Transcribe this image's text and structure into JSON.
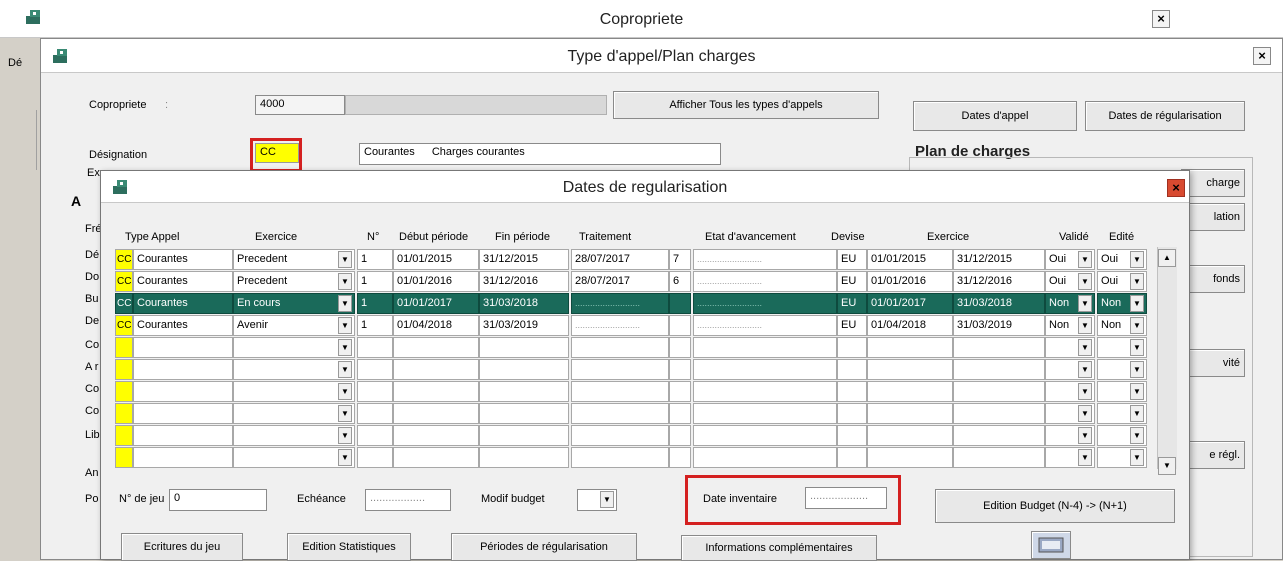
{
  "main_window": {
    "title": "Copropriete",
    "left_label": "Dé"
  },
  "type_window": {
    "title": "Type d'appel/Plan charges",
    "copropriete_label": "Copropriete",
    "copropriete_colon": ":",
    "copropriete_value": "4000",
    "afficher_button": "Afficher Tous les types d'appels",
    "dates_appel_button": "Dates d'appel",
    "dates_regul_button": "Dates de régularisation",
    "designation_label": "Désignation",
    "designation_code": "CC",
    "designation_short": "Courantes",
    "designation_long": "Charges courantes",
    "exercice_label_fragment": "Ex",
    "plan_charges_title": "Plan de charges",
    "side_labels": [
      "A",
      "Fré",
      "Dé",
      "Do",
      "Bu",
      "De",
      "Co",
      "A r",
      "Co",
      "Co",
      "Lib",
      "An",
      "Po"
    ],
    "right_buttons": [
      " charge",
      "lation",
      "fonds",
      "vité",
      "e régl."
    ]
  },
  "dialog": {
    "title": "Dates de regularisation",
    "columns": [
      "Type Appel",
      "Exercice",
      "N°",
      "Début période",
      "Fin période",
      "Traitement",
      "Etat d'avancement",
      "Devise",
      "Exercice",
      "Validé",
      "Edité"
    ],
    "rows": [
      {
        "code": "CC",
        "type": "Courantes",
        "exercice": "Precedent",
        "num": "1",
        "debut": "01/01/2015",
        "fin": "31/12/2015",
        "traitement": "28/07/2017",
        "step": "7",
        "etat": "",
        "devise": "EU",
        "ex_debut": "01/01/2015",
        "ex_fin": "31/12/2015",
        "valide": "Oui",
        "edite": "Oui"
      },
      {
        "code": "CC",
        "type": "Courantes",
        "exercice": "Precedent",
        "num": "1",
        "debut": "01/01/2016",
        "fin": "31/12/2016",
        "traitement": "28/07/2017",
        "step": "6",
        "etat": "",
        "devise": "EU",
        "ex_debut": "01/01/2016",
        "ex_fin": "31/12/2016",
        "valide": "Oui",
        "edite": "Oui"
      },
      {
        "code": "CC",
        "type": "Courantes",
        "exercice": "En cours",
        "num": "1",
        "debut": "01/01/2017",
        "fin": "31/03/2018",
        "traitement": "",
        "step": "",
        "etat": "",
        "devise": "EU",
        "ex_debut": "01/01/2017",
        "ex_fin": "31/03/2018",
        "valide": "Non",
        "edite": "Non"
      },
      {
        "code": "CC",
        "type": "Courantes",
        "exercice": "Avenir",
        "num": "1",
        "debut": "01/04/2018",
        "fin": "31/03/2019",
        "traitement": "",
        "step": "",
        "etat": "",
        "devise": "EU",
        "ex_debut": "01/04/2018",
        "ex_fin": "31/03/2019",
        "valide": "Non",
        "edite": "Non"
      }
    ],
    "num_jeu_label": "N° de jeu",
    "num_jeu_value": "0",
    "echeance_label": "Echéance",
    "modif_budget_label": "Modif budget",
    "date_inventaire_label": "Date inventaire",
    "edition_budget_button": "Edition Budget (N-4) -> (N+1)",
    "ecritures_button": "Ecritures du jeu",
    "edition_stats_button": "Edition Statistiques",
    "periodes_button": "Périodes de régularisation",
    "infos_button": "Informations complémentaires"
  },
  "colors": {
    "selected_row": "#1a6a5a",
    "highlight_yellow": "#ffff00",
    "annotation_red": "#d42020"
  }
}
